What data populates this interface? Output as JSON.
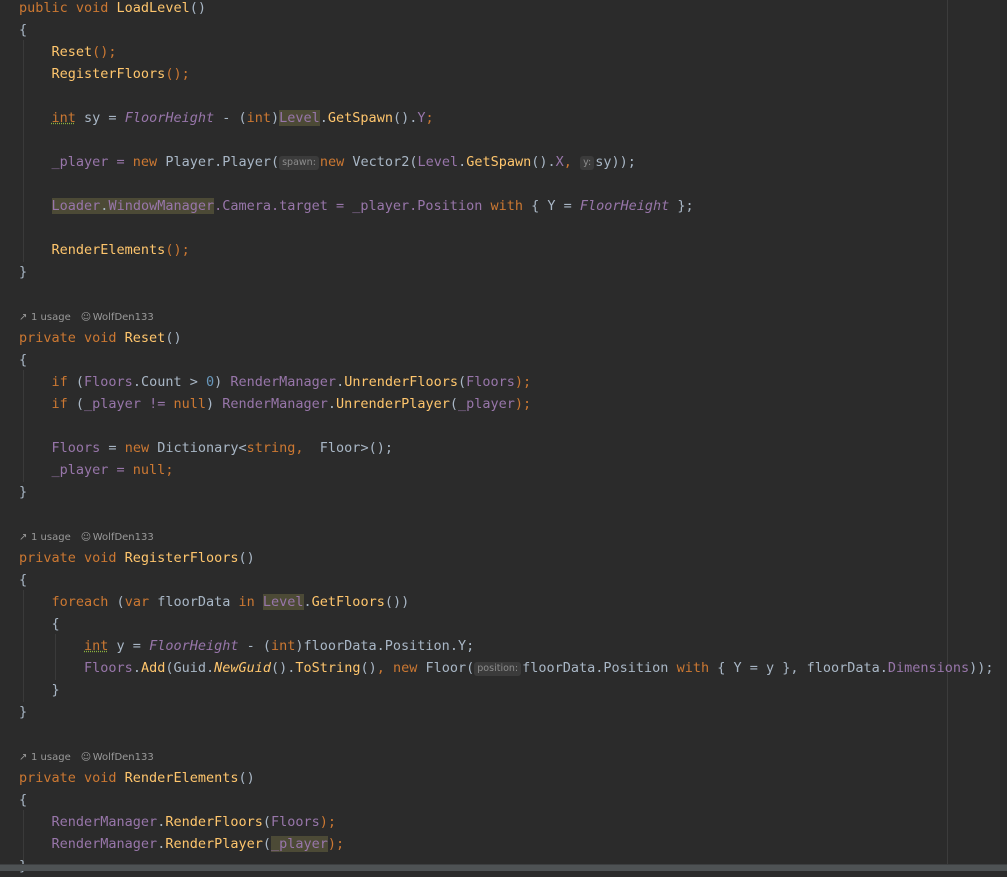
{
  "loadLevel": {
    "sig_pre": "public void ",
    "name": "LoadLevel",
    "sig_post": "()",
    "open": "{",
    "reset_call": "Reset",
    "register_call": "RegisterFloors",
    "call_end": "();",
    "int_kw": "int",
    "sy_decl": " sy = ",
    "floor_height": "FloorHeight",
    "minus_cast": " - (",
    "int_cast_close": ")",
    "level": "Level",
    "dot": ".",
    "get_spawn": "GetSpawn",
    "paren_dot": "().",
    "y_field": "Y",
    "semi": ";",
    "player_assign": "_player = ",
    "new_kw": "new",
    "player_ctor": " Player.Player(",
    "hint_spawn": "spawn:",
    "vector2": " Vector2(",
    "x_field": "X",
    "comma_sp": ", ",
    "hint_y": "y:",
    "sy_args": "sy));",
    "loader": "Loader",
    "window_manager": "WindowManager",
    "camera_target": ".Camera.target = _player.Position ",
    "with_kw": "with",
    "brace_y": " { Y = ",
    "close_brace_semi": " };",
    "render_call": "RenderElements",
    "close": "}"
  },
  "lens": {
    "usage": "1 usage",
    "author": "WolfDen133"
  },
  "reset": {
    "sig_pre": "private void ",
    "name": "Reset",
    "sig_post": "()",
    "if_kw": "if",
    "open_paren": " (",
    "floors": "Floors",
    "count": ".Count > ",
    "zero": "0",
    "close_paren_sp": ") ",
    "render_manager": "RenderManager",
    "unrender_floors": "UnrenderFloors",
    "paren_open": "(",
    "paren_close_semi": ");",
    "player_neq": "_player != ",
    "null_kw": "null",
    "unrender_player": "UnrenderPlayer",
    "player_arg": "_player",
    "floors_assign": " = ",
    "dictionary": " Dictionary<",
    "string_kw": "string",
    "floor_gen": " Floor>();",
    "player_null": "_player = ",
    "null_semi": ";"
  },
  "registerFloors": {
    "sig_pre": "private void ",
    "name": "RegisterFloors",
    "sig_post": "()",
    "foreach_kw": "foreach",
    "var_kw": "var",
    "floor_data": " floorData ",
    "in_kw": "in",
    "get_floors": "GetFloors",
    "get_floors_end": "())",
    "y_decl": " y = ",
    "fd_position": "floorData.Position.Y;",
    "add_call": "Add",
    "guid": "Guid.",
    "new_guid": "NewGuid",
    "to_string": "ToString",
    "floor_ctor": " Floor(",
    "hint_position": "position:",
    "fd_pos_with": "floorData.Position ",
    "y_eq_y": " { Y = y }, floorData.",
    "dimensions": "Dimensions",
    "end": "));"
  },
  "renderElements": {
    "sig_pre": "private void ",
    "name": "RenderElements",
    "sig_post": "()",
    "render_floors": "RenderFloors",
    "render_player": "RenderPlayer"
  }
}
